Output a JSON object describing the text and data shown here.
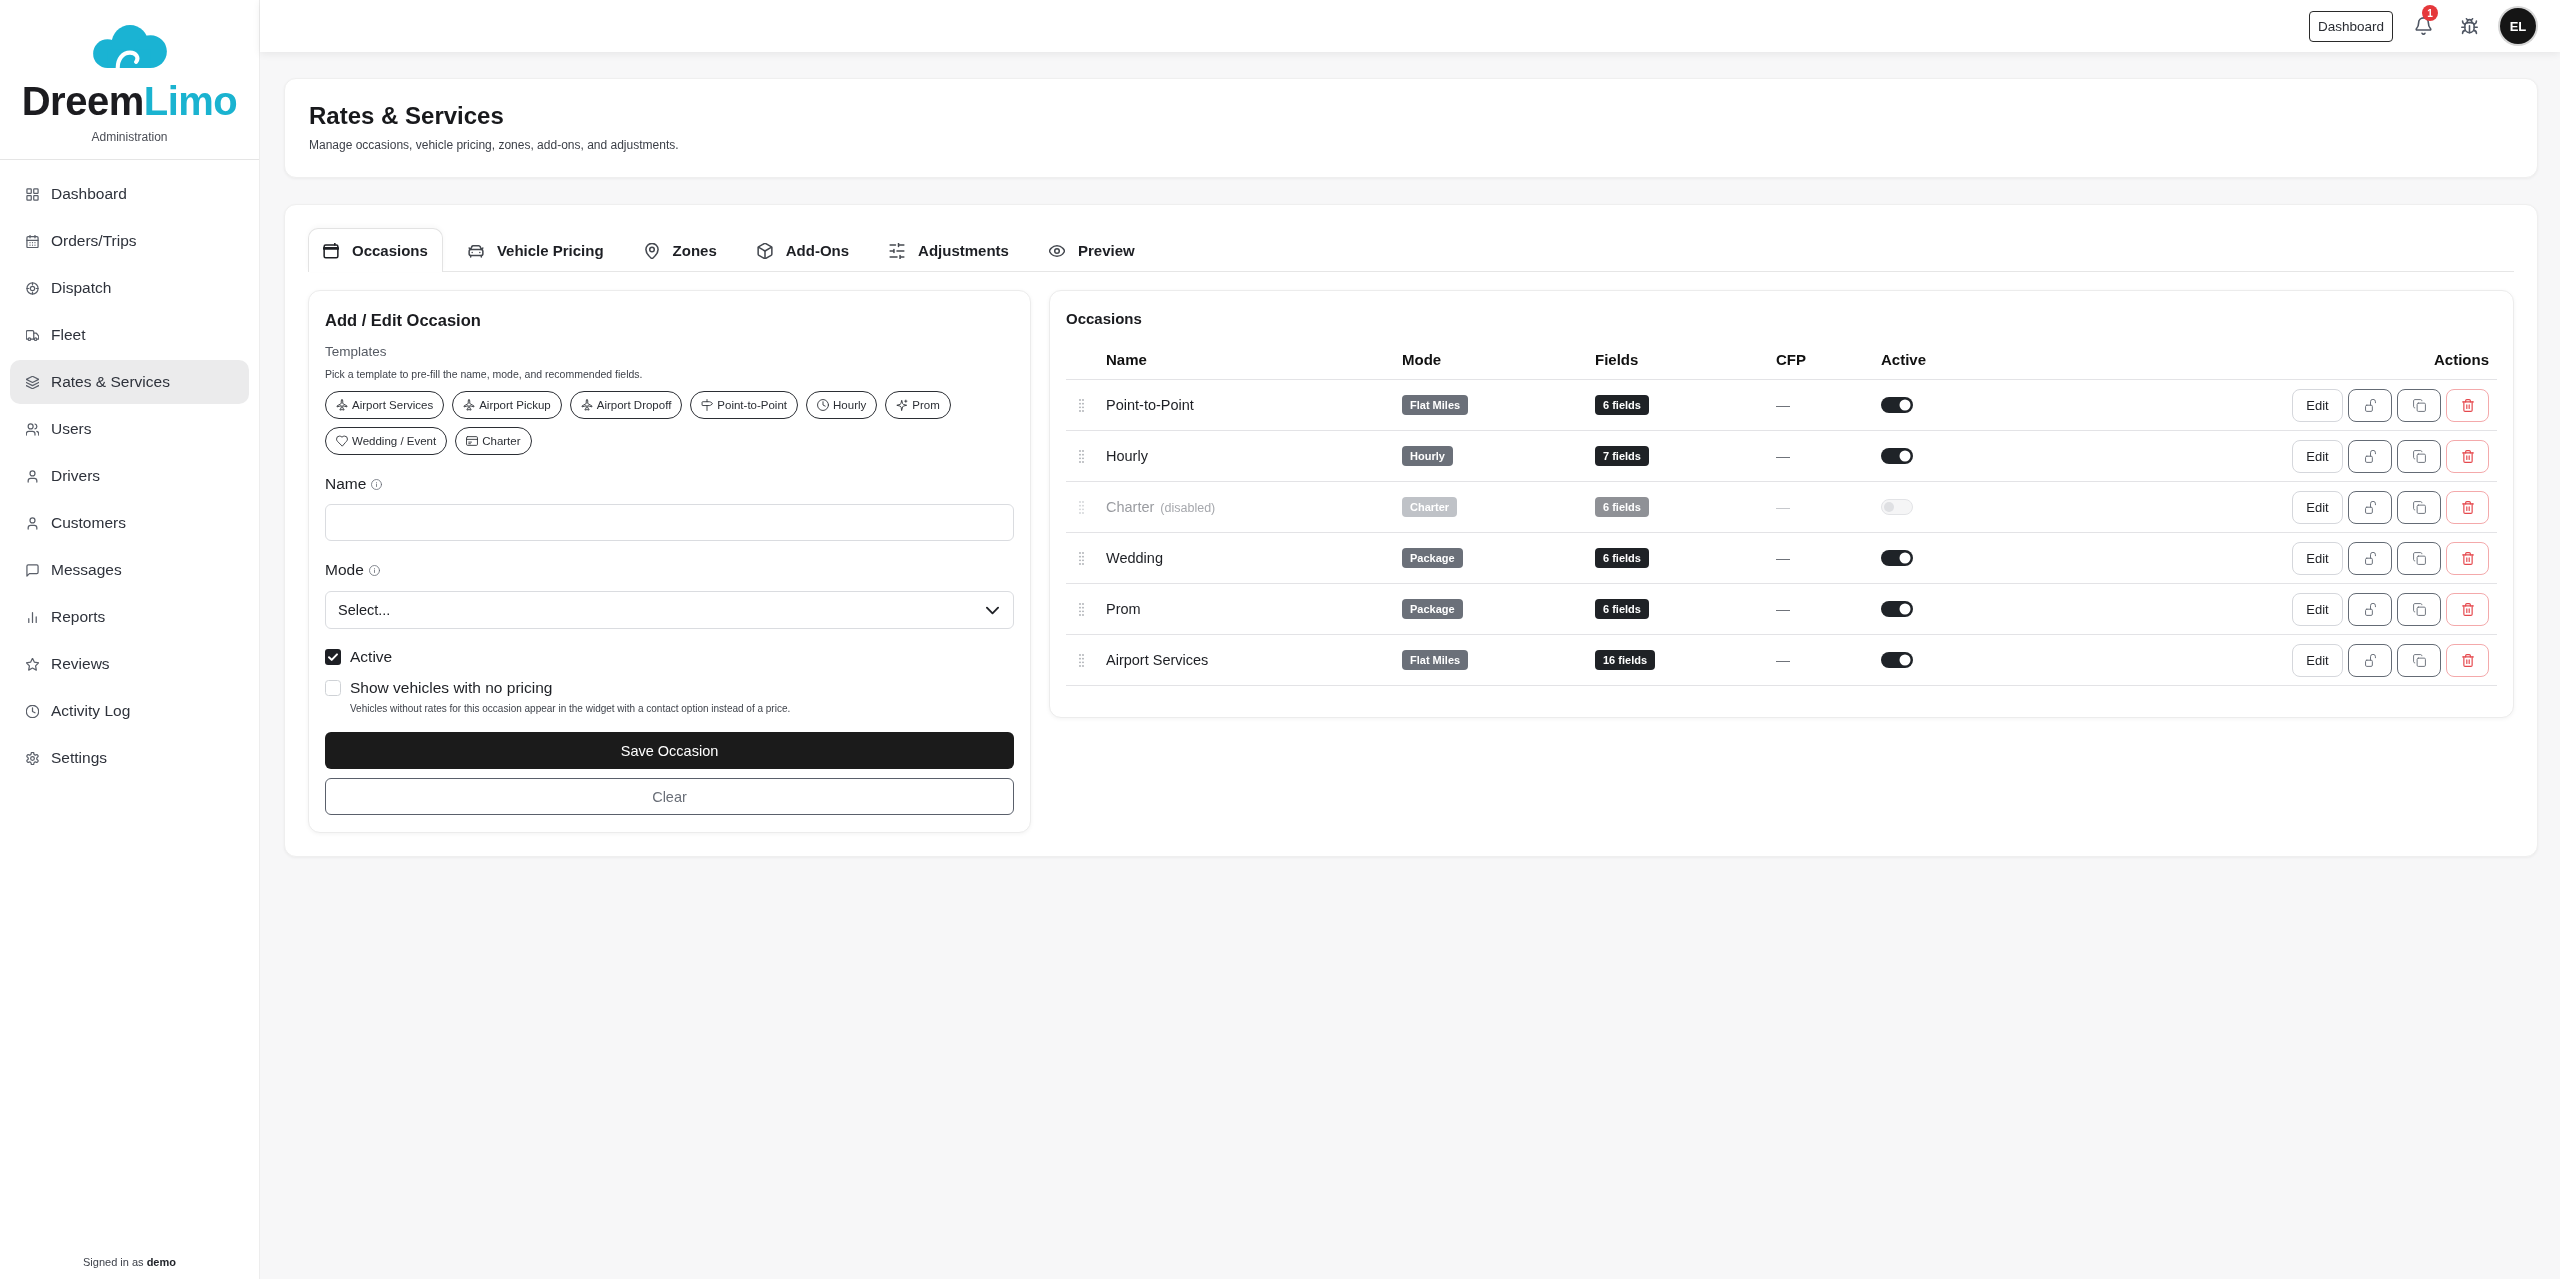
{
  "sidebar": {
    "logo": {
      "name": "Dreem",
      "accent": "Limo",
      "tagline": "Administration"
    },
    "items": [
      {
        "label": "Dashboard",
        "selected": false
      },
      {
        "label": "Orders/Trips",
        "selected": false
      },
      {
        "label": "Dispatch",
        "selected": false
      },
      {
        "label": "Fleet",
        "selected": false
      },
      {
        "label": "Rates & Services",
        "selected": true
      },
      {
        "label": "Users",
        "selected": false
      },
      {
        "label": "Drivers",
        "selected": false
      },
      {
        "label": "Customers",
        "selected": false
      },
      {
        "label": "Messages",
        "selected": false
      },
      {
        "label": "Reports",
        "selected": false
      },
      {
        "label": "Reviews",
        "selected": false
      },
      {
        "label": "Activity Log",
        "selected": false
      },
      {
        "label": "Settings",
        "selected": false
      }
    ],
    "footer": "Signed in as **demo**"
  },
  "topbar": {
    "button": "Dashboard",
    "notification_count": "1",
    "avatar": "EL"
  },
  "header": {
    "title": "Rates & Services",
    "subtitle": "Manage occasions, vehicle pricing, zones, add-ons, and adjustments."
  },
  "tabs": [
    {
      "label": "Occasions",
      "selected": true
    },
    {
      "label": "Vehicle Pricing",
      "selected": false
    },
    {
      "label": "Zones",
      "selected": false
    },
    {
      "label": "Add-Ons",
      "selected": false
    },
    {
      "label": "Adjustments",
      "selected": false
    },
    {
      "label": "Preview",
      "selected": false
    }
  ],
  "form": {
    "title": "Add / Edit Occasion",
    "templates_label": "Templates",
    "templates_hint": "Pick a template to pre-fill the name, mode, and recommended fields.",
    "templates": [
      "Airport Services",
      "Airport Pickup",
      "Airport Dropoff",
      "Point-to-Point",
      "Hourly",
      "Prom",
      "Wedding / Event",
      "Charter"
    ],
    "name_field": {
      "label": "Name"
    },
    "mode_field": {
      "label": "Mode",
      "value": "Select..."
    },
    "checkboxes": [
      {
        "label": "Active",
        "checked": true
      },
      {
        "label": "Show vehicles with no pricing",
        "checked": false,
        "hint": "Vehicles without rates for this occasion appear in the widget with a contact option instead of a price."
      }
    ],
    "save_button": "Save Occasion",
    "clear_button": "Clear"
  },
  "occasions": {
    "title": "Occasions",
    "columns": [
      "Name",
      "Mode",
      "Fields",
      "CFP",
      "Active",
      "Actions"
    ],
    "rows": [
      {
        "name": "Point-to-Point",
        "mode": "Flat Miles",
        "fields": "6 fields",
        "cfp": "—",
        "active": true,
        "disabled": false,
        "edit": "Edit"
      },
      {
        "name": "Hourly",
        "mode": "Hourly",
        "fields": "7 fields",
        "cfp": "—",
        "active": true,
        "disabled": false,
        "edit": "Edit"
      },
      {
        "name": "Charter",
        "note": "(disabled)",
        "mode": "Charter",
        "fields": "6 fields",
        "cfp": "—",
        "active": false,
        "disabled": true,
        "edit": "Edit"
      },
      {
        "name": "Wedding",
        "mode": "Package",
        "fields": "6 fields",
        "cfp": "—",
        "active": true,
        "disabled": false,
        "edit": "Edit"
      },
      {
        "name": "Prom",
        "mode": "Package",
        "fields": "6 fields",
        "cfp": "—",
        "active": true,
        "disabled": false,
        "edit": "Edit"
      },
      {
        "name": "Airport Services",
        "mode": "Flat Miles",
        "fields": "16 fields",
        "cfp": "—",
        "active": true,
        "disabled": false,
        "edit": "Edit"
      }
    ]
  }
}
